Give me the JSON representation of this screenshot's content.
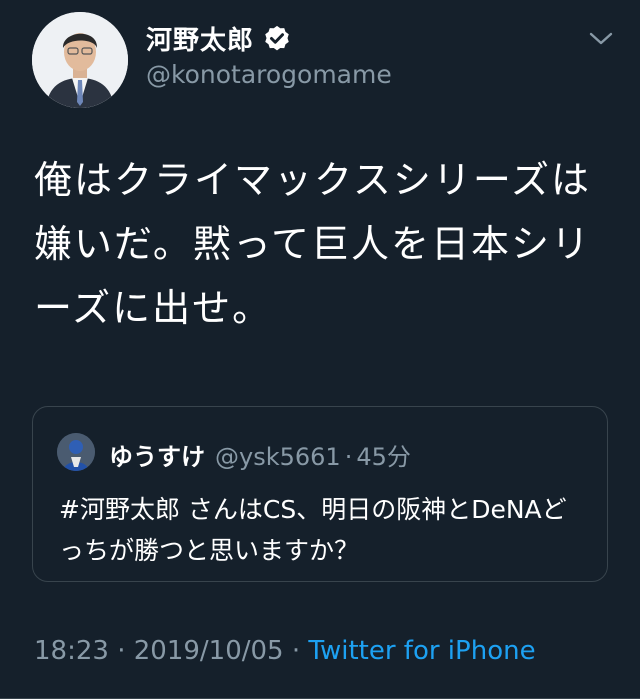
{
  "author": {
    "display_name": "河野太郎",
    "handle": "@konotarogomame",
    "verified": true
  },
  "tweet": {
    "text": "俺はクライマックスシリーズは嫌いだ。黙って巨人を日本シリーズに出せ。"
  },
  "quoted": {
    "display_name": "ゆうすけ",
    "handle": "@ysk5661",
    "separator": "·",
    "time": "45分",
    "text": "#河野太郎 さんはCS、明日の阪神とDeNAどっちが勝つと思いますか？"
  },
  "meta": {
    "time": "18:23",
    "separator_1": " · ",
    "date": "2019/10/05",
    "separator_2": " · ",
    "source": "Twitter for iPhone"
  },
  "icons": {
    "verified": "verified-badge-icon",
    "menu": "chevron-down-icon"
  },
  "colors": {
    "background": "#15202b",
    "secondary_text": "#8899a6",
    "link": "#1da1f2",
    "border": "#38444d"
  }
}
